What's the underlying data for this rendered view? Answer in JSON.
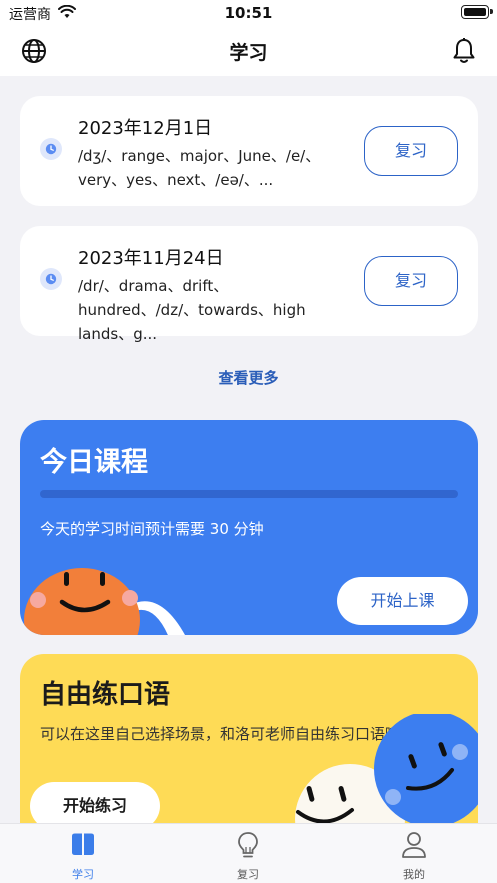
{
  "status_bar": {
    "carrier": "运营商",
    "time": "10:51"
  },
  "nav": {
    "title": "学习",
    "left_icon": "globe-icon",
    "right_icon": "bell-icon"
  },
  "review_items": [
    {
      "date": "2023年12月1日",
      "words": "/dʒ/、range、major、June、/e/、very、yes、next、/eə/、...",
      "button": "复习"
    },
    {
      "date": "2023年11月24日",
      "words": "/dr/、drama、drift、hundred、/dz/、towards、high lands、g...",
      "button": "复习"
    }
  ],
  "see_more": "查看更多",
  "today_course": {
    "title": "今日课程",
    "description": "今天的学习时间预计需要 30 分钟",
    "progress": 0,
    "button": "开始上课",
    "color": "#3d7ef0"
  },
  "free_speaking": {
    "title": "自由练口语",
    "description": "可以在这里自己选择场景，和洛可老师自由练习口语哦",
    "button": "开始练习",
    "color": "#fedb56"
  },
  "tabs": [
    {
      "label": "学习",
      "icon": "book-icon",
      "active": true
    },
    {
      "label": "复习",
      "icon": "lightbulb-icon",
      "active": false
    },
    {
      "label": "我的",
      "icon": "person-icon",
      "active": false
    }
  ],
  "accent_color": "#3b7de9"
}
